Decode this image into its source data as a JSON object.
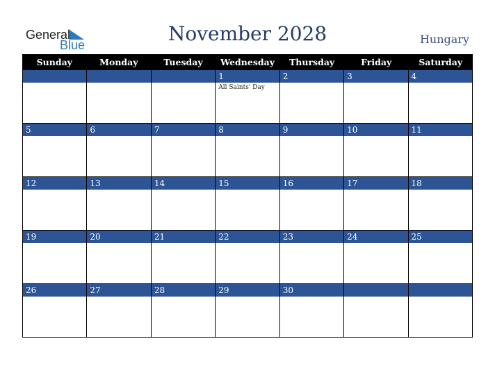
{
  "brand": {
    "line1": "General",
    "line2": "Blue"
  },
  "title": "November 2028",
  "country": "Hungary",
  "colors": {
    "band": "#2d5596",
    "header": "#000000",
    "title": "#253a66"
  },
  "weekdays": [
    "Sunday",
    "Monday",
    "Tuesday",
    "Wednesday",
    "Thursday",
    "Friday",
    "Saturday"
  ],
  "weeks": [
    [
      {
        "d": ""
      },
      {
        "d": ""
      },
      {
        "d": ""
      },
      {
        "d": "1",
        "h": "All Saints' Day"
      },
      {
        "d": "2"
      },
      {
        "d": "3"
      },
      {
        "d": "4"
      }
    ],
    [
      {
        "d": "5"
      },
      {
        "d": "6"
      },
      {
        "d": "7"
      },
      {
        "d": "8"
      },
      {
        "d": "9"
      },
      {
        "d": "10"
      },
      {
        "d": "11"
      }
    ],
    [
      {
        "d": "12"
      },
      {
        "d": "13"
      },
      {
        "d": "14"
      },
      {
        "d": "15"
      },
      {
        "d": "16"
      },
      {
        "d": "17"
      },
      {
        "d": "18"
      }
    ],
    [
      {
        "d": "19"
      },
      {
        "d": "20"
      },
      {
        "d": "21"
      },
      {
        "d": "22"
      },
      {
        "d": "23"
      },
      {
        "d": "24"
      },
      {
        "d": "25"
      }
    ],
    [
      {
        "d": "26"
      },
      {
        "d": "27"
      },
      {
        "d": "28"
      },
      {
        "d": "29"
      },
      {
        "d": "30"
      },
      {
        "d": ""
      },
      {
        "d": ""
      }
    ]
  ]
}
